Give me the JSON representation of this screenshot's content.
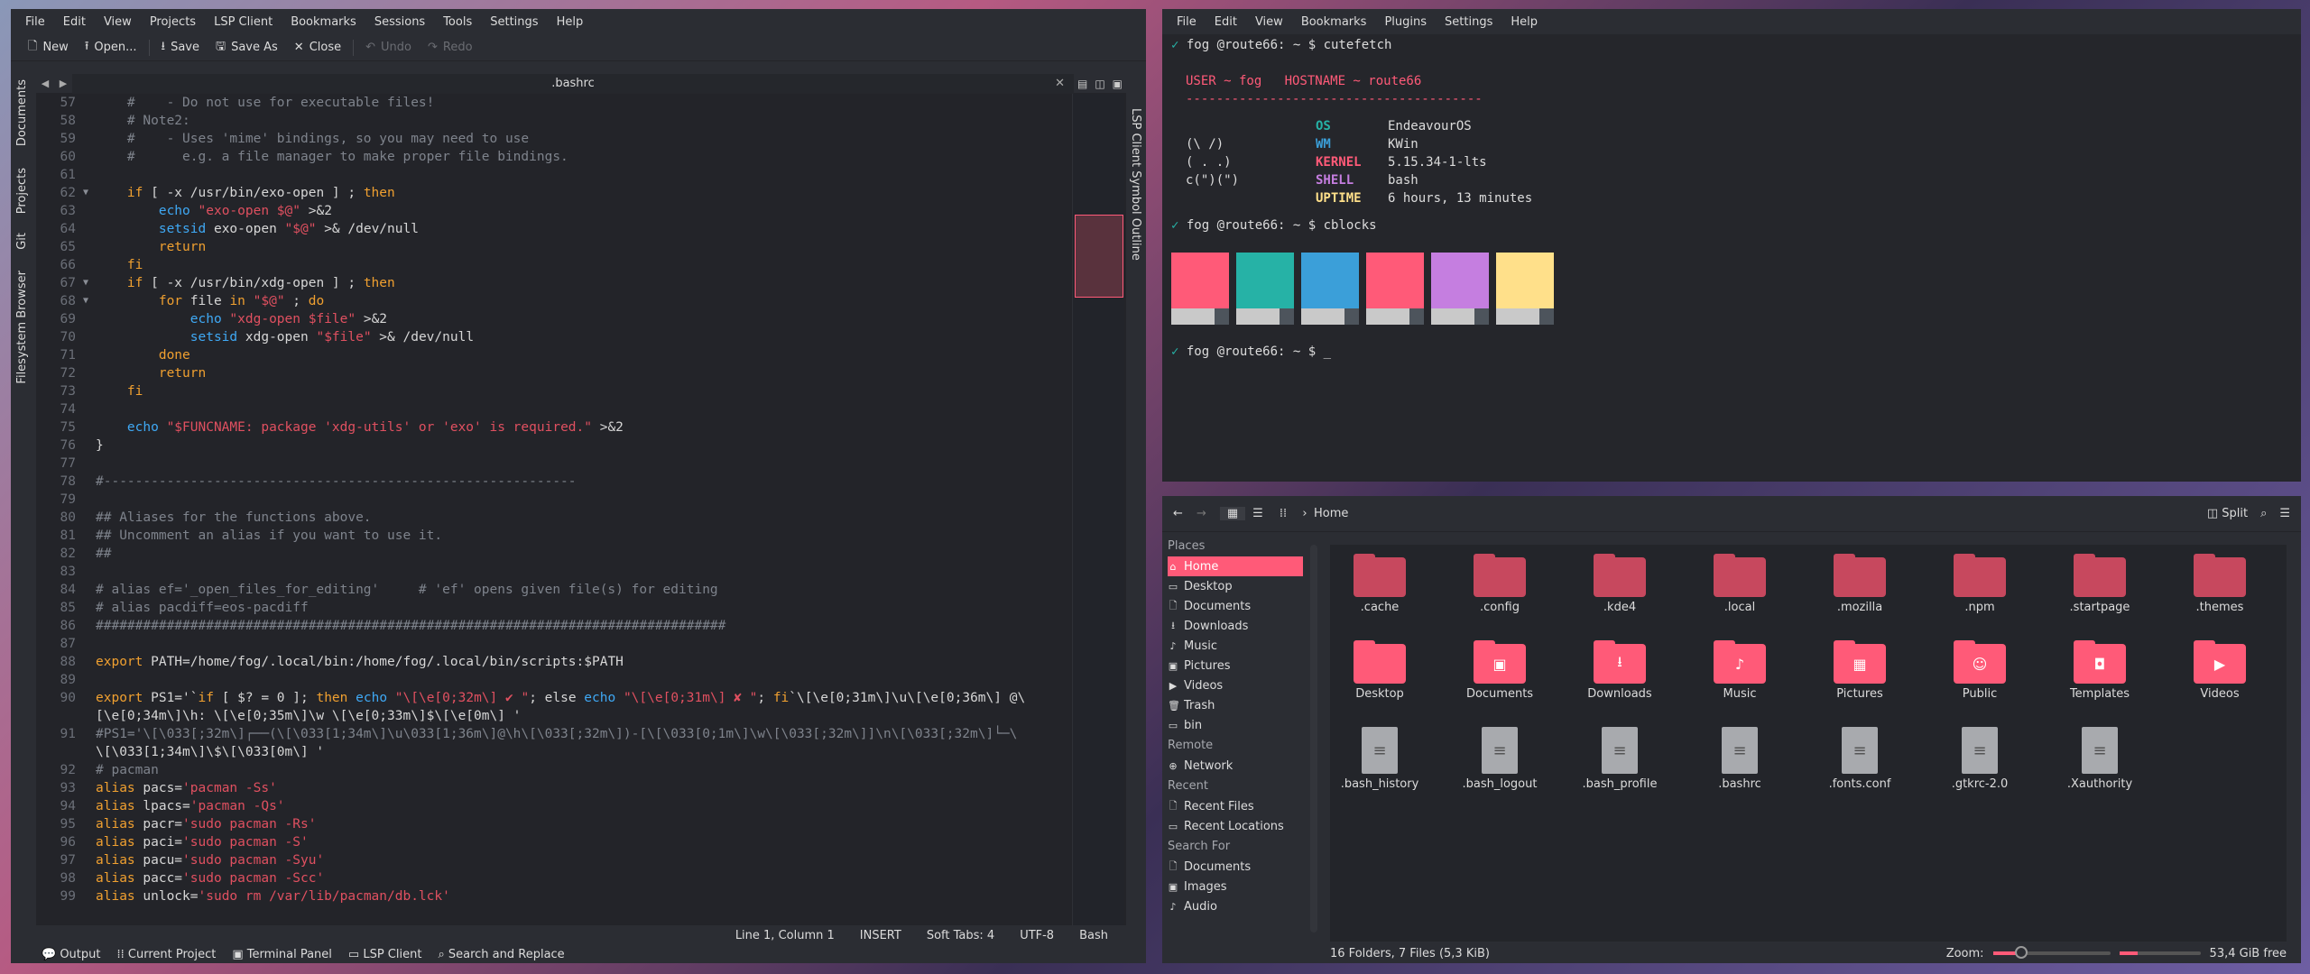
{
  "colors": {
    "accent": "#ff5a78",
    "teal": "#26b2a6",
    "blue": "#3b9fd9",
    "violet": "#c57ee0",
    "yellow": "#ffe08a"
  },
  "kate": {
    "menu": [
      "File",
      "Edit",
      "View",
      "Projects",
      "LSP Client",
      "Bookmarks",
      "Sessions",
      "Tools",
      "Settings",
      "Help"
    ],
    "toolbar": {
      "new": "New",
      "open": "Open...",
      "save": "Save",
      "save_as": "Save As",
      "close": "Close",
      "undo": "Undo",
      "redo": "Redo"
    },
    "left_tabs": [
      "Documents",
      "Projects",
      "Git",
      "Filesystem Browser"
    ],
    "right_tabs": [
      "LSP Client Symbol Outline"
    ],
    "tab_title": ".bashrc",
    "lines": [
      {
        "n": "57",
        "t": "    #    - Do not use for executable files!"
      },
      {
        "n": "58",
        "t": "    # Note2:"
      },
      {
        "n": "59",
        "t": "    #    - Uses 'mime' bindings, so you may need to use"
      },
      {
        "n": "60",
        "t": "    #      e.g. a file manager to make proper file bindings."
      },
      {
        "n": "61",
        "t": ""
      },
      {
        "n": "62",
        "t": "    if [ -x /usr/bin/exo-open ] ; then",
        "fold": "1"
      },
      {
        "n": "63",
        "t": "        echo \"exo-open $@\" >&2"
      },
      {
        "n": "64",
        "t": "        setsid exo-open \"$@\" >& /dev/null"
      },
      {
        "n": "65",
        "t": "        return"
      },
      {
        "n": "66",
        "t": "    fi"
      },
      {
        "n": "67",
        "t": "    if [ -x /usr/bin/xdg-open ] ; then",
        "fold": "1"
      },
      {
        "n": "68",
        "t": "        for file in \"$@\" ; do",
        "fold": "1"
      },
      {
        "n": "69",
        "t": "            echo \"xdg-open $file\" >&2"
      },
      {
        "n": "70",
        "t": "            setsid xdg-open \"$file\" >& /dev/null"
      },
      {
        "n": "71",
        "t": "        done"
      },
      {
        "n": "72",
        "t": "        return"
      },
      {
        "n": "73",
        "t": "    fi"
      },
      {
        "n": "74",
        "t": ""
      },
      {
        "n": "75",
        "t": "    echo \"$FUNCNAME: package 'xdg-utils' or 'exo' is required.\" >&2"
      },
      {
        "n": "76",
        "t": "}"
      },
      {
        "n": "77",
        "t": ""
      },
      {
        "n": "78",
        "t": "#------------------------------------------------------------"
      },
      {
        "n": "79",
        "t": ""
      },
      {
        "n": "80",
        "t": "## Aliases for the functions above."
      },
      {
        "n": "81",
        "t": "## Uncomment an alias if you want to use it."
      },
      {
        "n": "82",
        "t": "##"
      },
      {
        "n": "83",
        "t": ""
      },
      {
        "n": "84",
        "t": "# alias ef='_open_files_for_editing'     # 'ef' opens given file(s) for editing"
      },
      {
        "n": "85",
        "t": "# alias pacdiff=eos-pacdiff"
      },
      {
        "n": "86",
        "t": "################################################################################"
      },
      {
        "n": "87",
        "t": ""
      },
      {
        "n": "88",
        "t": "export PATH=/home/fog/.local/bin:/home/fog/.local/bin/scripts:$PATH"
      },
      {
        "n": "89",
        "t": ""
      },
      {
        "n": "90",
        "t": "export PS1='`if [ $? = 0 ]; then echo \"\\[\\e[0;32m\\] ✔ \"; else echo \"\\[\\e[0;31m\\] ✘ \"; fi`\\[\\e[0;31m\\]\\u\\[\\e[0;36m\\] @\\"
      },
      {
        "n": "",
        "t": "[\\e[0;34m\\]\\h: \\[\\e[0;35m\\]\\w \\[\\e[0;33m\\]$\\[\\e[0m\\] '"
      },
      {
        "n": "91",
        "t": "#PS1='\\[\\033[;32m\\]┌──(\\[\\033[1;34m\\]\\u\\033[1;36m\\]@\\h\\[\\033[;32m\\])-[\\[\\033[0;1m\\]\\w\\[\\033[;32m\\]]\\n\\[\\033[;32m\\]└─\\"
      },
      {
        "n": "",
        "t": "\\[\\033[1;34m\\]\\$\\[\\033[0m\\] '"
      },
      {
        "n": "92",
        "t": "# pacman"
      },
      {
        "n": "93",
        "t": "alias pacs='pacman -Ss'"
      },
      {
        "n": "94",
        "t": "alias lpacs='pacman -Qs'"
      },
      {
        "n": "95",
        "t": "alias pacr='sudo pacman -Rs'"
      },
      {
        "n": "96",
        "t": "alias paci='sudo pacman -S'"
      },
      {
        "n": "97",
        "t": "alias pacu='sudo pacman -Syu'"
      },
      {
        "n": "98",
        "t": "alias pacc='sudo pacman -Scc'"
      },
      {
        "n": "99",
        "t": "alias unlock='sudo rm /var/lib/pacman/db.lck'"
      }
    ],
    "status": {
      "cursor": "Line 1, Column 1",
      "mode": "INSERT",
      "indent": "Soft Tabs: 4",
      "encoding": "UTF-8",
      "syntax": "Bash"
    },
    "toolviews": [
      "Output",
      "Current Project",
      "Terminal Panel",
      "LSP Client",
      "Search and Replace"
    ]
  },
  "terminal": {
    "menu": [
      "File",
      "Edit",
      "View",
      "Bookmarks",
      "Plugins",
      "Settings",
      "Help"
    ],
    "prompt1": "fog @route66: ~ $ cutefetch",
    "user_line": "USER ~ fog   HOSTNAME ~ route66",
    "rule": "---------------------------------------",
    "info": [
      {
        "k": "OS",
        "v": "EndeavourOS",
        "art": ""
      },
      {
        "k": "WM",
        "v": "KWin",
        "art": "(\\ /)"
      },
      {
        "k": "KERNEL",
        "v": "5.15.34-1-lts",
        "art": "( . .)"
      },
      {
        "k": "SHELL",
        "v": "bash",
        "art": "c(\")(\")"
      },
      {
        "k": "UPTIME",
        "v": "6 hours, 13 minutes",
        "art": ""
      }
    ],
    "prompt2": "fog @route66: ~ $ cblocks",
    "prompt3": "fog @route66: ~ $ _"
  },
  "dolphin": {
    "path": "Home",
    "split": "Split",
    "places_header": "Places",
    "places": [
      "Home",
      "Desktop",
      "Documents",
      "Downloads",
      "Music",
      "Pictures",
      "Videos",
      "Trash",
      "bin"
    ],
    "remote_header": "Remote",
    "remote": [
      "Network"
    ],
    "recent_header": "Recent",
    "recent": [
      "Recent Files",
      "Recent Locations"
    ],
    "search_header": "Search For",
    "search": [
      "Documents",
      "Images",
      "Audio"
    ],
    "items": [
      ".cache",
      ".config",
      ".kde4",
      ".local",
      ".mozilla",
      ".npm",
      ".startpage",
      ".themes",
      "Desktop",
      "Documents",
      "Downloads",
      "Music",
      "Pictures",
      "Public",
      "Templates",
      "Videos",
      ".bash_history",
      ".bash_logout",
      ".bash_profile",
      ".bashrc",
      ".fonts.conf",
      ".gtkrc-2.0",
      ".Xauthority"
    ],
    "status": "16 Folders, 7 Files (5,3 KiB)",
    "zoom": "Zoom:",
    "free": "53,4 GiB free"
  }
}
